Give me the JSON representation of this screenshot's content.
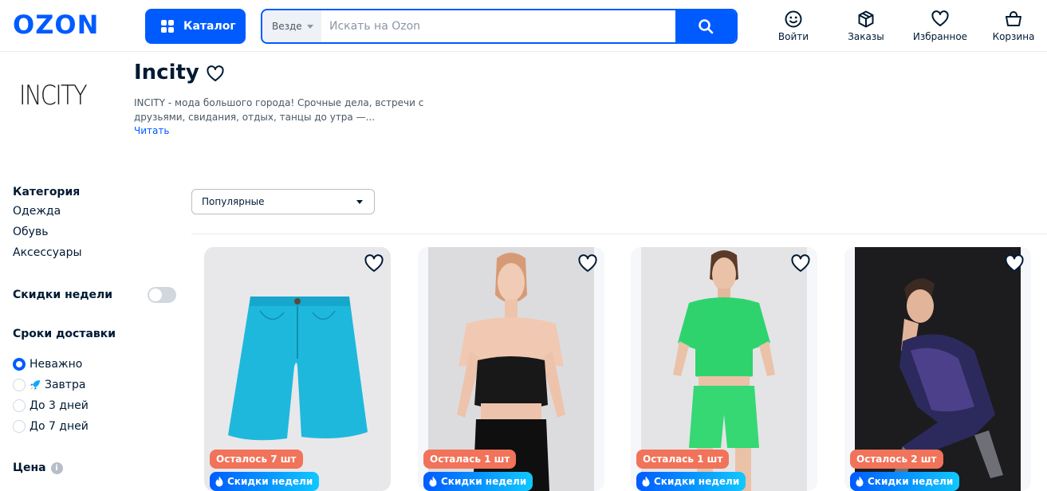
{
  "header": {
    "logo": "OZON",
    "catalog_label": "Каталог",
    "search_scope": "Везде",
    "search_placeholder": "Искать на Ozon",
    "login_label": "Войти",
    "orders_label": "Заказы",
    "favorites_label": "Избранное",
    "cart_label": "Корзина"
  },
  "brand": {
    "logo_text": "INCITY",
    "title": "Incity",
    "description": "INCITY - мода большого города! Срочные дела, встречи с друзьями, свидания, отдых, танцы до утра —...",
    "read_more": "Читать"
  },
  "sidebar": {
    "category_title": "Категория",
    "categories": [
      {
        "label": "Одежда"
      },
      {
        "label": "Обувь"
      },
      {
        "label": "Аксессуары"
      }
    ],
    "weekly_deals_label": "Скидки недели",
    "weekly_deals_enabled": false,
    "delivery_title": "Сроки доставки",
    "delivery_options": [
      {
        "label": "Неважно",
        "selected": true,
        "icon": ""
      },
      {
        "label": "Завтра",
        "selected": false,
        "icon": "rocket-icon"
      },
      {
        "label": "До 3 дней",
        "selected": false,
        "icon": ""
      },
      {
        "label": "До 7 дней",
        "selected": false,
        "icon": ""
      }
    ],
    "price_title": "Цена"
  },
  "sort": {
    "selected": "Популярные"
  },
  "products": [
    {
      "stock_badge": "Осталось 7 шт",
      "deal_badge": "Скидки недели",
      "image": "turquoise-shorts"
    },
    {
      "stock_badge": "Осталась 1 шт",
      "deal_badge": "Скидки недели",
      "image": "woman-black-corset"
    },
    {
      "stock_badge": "Осталась 1 шт",
      "deal_badge": "Скидки недели",
      "image": "woman-green-set"
    },
    {
      "stock_badge": "Осталось 2 шт",
      "deal_badge": "Скидки недели",
      "image": "woman-sequin-dress"
    }
  ],
  "colors": {
    "accent": "#005bff",
    "stock_badge": "#f1735a",
    "deal_gradient_start": "#005bff",
    "deal_gradient_end": "#10c8ff"
  }
}
